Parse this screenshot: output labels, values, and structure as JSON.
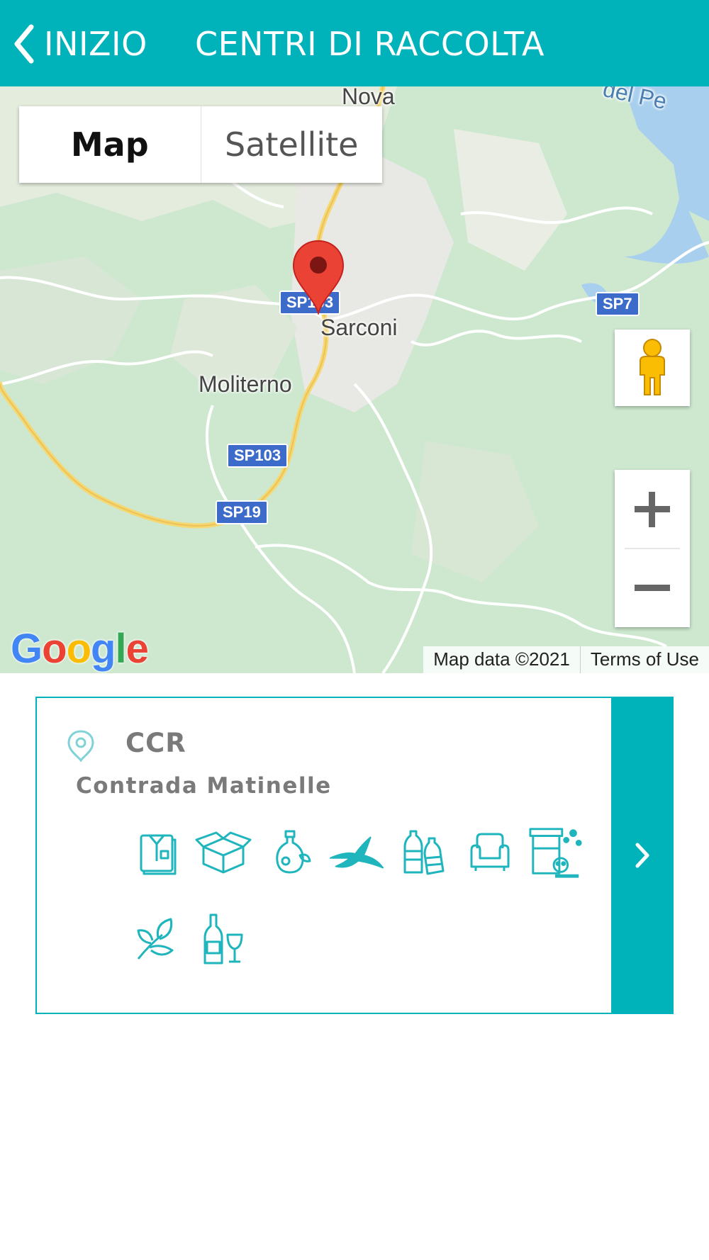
{
  "header": {
    "back_label": "INIZIO",
    "title": "CENTRI DI RACCOLTA",
    "background": "#00b3bb"
  },
  "map": {
    "type_options": [
      "Map",
      "Satellite"
    ],
    "selected_type": "Map",
    "places": [
      "Nova",
      "Sarconi",
      "Moliterno",
      "del Pe"
    ],
    "roads": [
      "SP103",
      "SP7",
      "SP103",
      "SP19"
    ],
    "logo": "Google",
    "attribution": "Map data ©2021",
    "terms": "Terms of Use",
    "icons": [
      "location-pin-icon",
      "pegman-icon",
      "zoom-in-icon",
      "zoom-out-icon"
    ]
  },
  "card": {
    "title": "CCR",
    "address": "Contrada Matinelle",
    "accent": "#00b3bb",
    "waste_icons": [
      "clothes-icon",
      "cardboard-box-icon",
      "cooking-oil-icon",
      "banana-peel-icon",
      "plastic-bottles-icon",
      "armchair-icon",
      "hazardous-waste-icon",
      "leaves-icon",
      "glass-bottle-icon"
    ]
  }
}
